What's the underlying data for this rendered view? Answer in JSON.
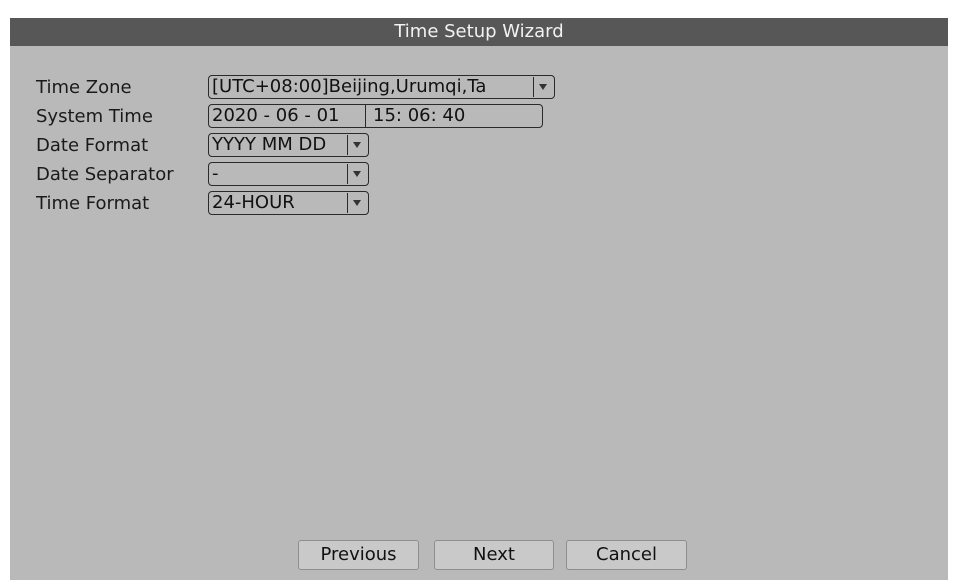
{
  "window": {
    "title": "Time Setup Wizard"
  },
  "form": {
    "time_zone": {
      "label": "Time Zone",
      "value": "[UTC+08:00]Beijing,Urumqi,Ta"
    },
    "system_time": {
      "label": "System Time",
      "date": "2020 - 06 - 01",
      "time": "15: 06: 40"
    },
    "date_format": {
      "label": "Date Format",
      "value": "YYYY MM DD"
    },
    "date_separator": {
      "label": "Date Separator",
      "value": "-"
    },
    "time_format": {
      "label": "Time Format",
      "value": "24-HOUR"
    }
  },
  "buttons": {
    "previous": "Previous",
    "next": "Next",
    "cancel": "Cancel"
  }
}
